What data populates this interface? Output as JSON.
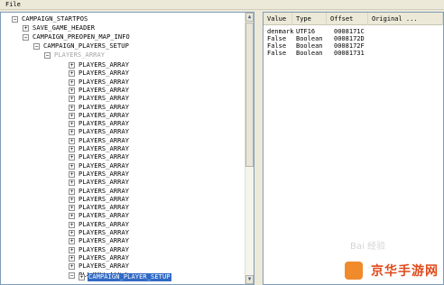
{
  "menu": {
    "file": "File"
  },
  "tree": {
    "root": "CAMPAIGN_STARTPOS",
    "save_game_header": "SAVE_GAME_HEADER",
    "preopen": "CAMPAIGN_PREOPEN_MAP_INFO",
    "players_setup": "CAMPAIGN_PLAYERS_SETUP",
    "players_array_header": "PLAYERS_ARRAY",
    "players_array_item": "PLAYERS_ARRAY",
    "player_setup": "CAMPAIGN_PLAYER_SETUP"
  },
  "list": {
    "columns": [
      "Value",
      "Type",
      "Offset",
      "Original ..."
    ],
    "rows": [
      [
        "denmark",
        "UTF16",
        "0008171C",
        ""
      ],
      [
        "False",
        "Boolean",
        "0008172D",
        ""
      ],
      [
        "False",
        "Boolean",
        "0008172F",
        ""
      ],
      [
        "False",
        "Boolean",
        "00081731",
        ""
      ]
    ]
  },
  "watermark": {
    "text": "京华手游网",
    "faint": "Bai 经验"
  }
}
